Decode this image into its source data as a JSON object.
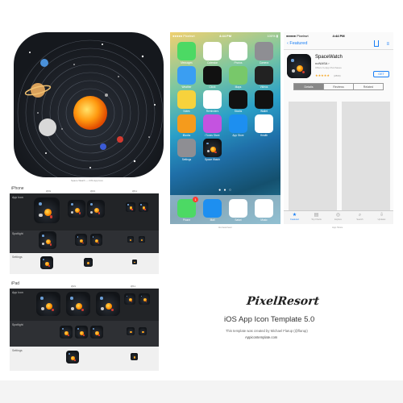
{
  "big_icon": {
    "caption": "Space Watch — iOS App Icon"
  },
  "iphone": {
    "label": "iPhone",
    "columns": [
      "@3x",
      "@2x",
      "@1x"
    ],
    "rows": [
      "App Icon",
      "Spotlight",
      "Settings"
    ]
  },
  "ipad": {
    "label": "iPad",
    "columns": [
      "@2x",
      "@1x"
    ],
    "rows": [
      "App Icon",
      "Spotlight",
      "Settings"
    ]
  },
  "home": {
    "carrier": "●●●●● Pixelrsrt",
    "time": "4:44 PM",
    "battery": "100% ▮",
    "apps": [
      {
        "label": "Messages",
        "color": "#4cd964"
      },
      {
        "label": "Calendar",
        "color": "#ffffff"
      },
      {
        "label": "Photos",
        "color": "#ffffff"
      },
      {
        "label": "Camera",
        "color": "#8e8e93"
      },
      {
        "label": "Weather",
        "color": "#3a9ef2"
      },
      {
        "label": "Clock",
        "color": "#111111"
      },
      {
        "label": "Maps",
        "color": "#78c86a"
      },
      {
        "label": "Videos",
        "color": "#222222"
      },
      {
        "label": "Notes",
        "color": "#f7d23c"
      },
      {
        "label": "Reminders",
        "color": "#ffffff"
      },
      {
        "label": "Stocks",
        "color": "#111111"
      },
      {
        "label": "Wallet",
        "color": "#111111"
      },
      {
        "label": "iBooks",
        "color": "#f59b1c"
      },
      {
        "label": "iTunes Store",
        "color": "#c453e0"
      },
      {
        "label": "App Store",
        "color": "#1d8ff0"
      },
      {
        "label": "Health",
        "color": "#ffffff"
      },
      {
        "label": "Settings",
        "color": "#8e8e93"
      },
      {
        "label": "Space Watch",
        "color": "#15181d"
      }
    ],
    "dock": [
      {
        "label": "Phone",
        "color": "#4cd964",
        "badge": "1"
      },
      {
        "label": "Mail",
        "color": "#1d8ff0"
      },
      {
        "label": "Safari",
        "color": "#ffffff"
      },
      {
        "label": "Music",
        "color": "#ffffff"
      }
    ],
    "page_dots": "● ● ○",
    "caption": "Homescreen"
  },
  "store": {
    "carrier": "●●●●● Pixelrsrt",
    "time": "4:44 PM",
    "back": "‹ Featured",
    "app_name": "SpaceWatch",
    "developer": "noNASA ›",
    "iap": "Offers In-App Purchases",
    "stars": "★★★★★",
    "rating_count": "(2869)",
    "get": "GET",
    "segments": [
      "Details",
      "Reviews",
      "Related"
    ],
    "tabs": [
      {
        "icon": "★",
        "label": "Featured"
      },
      {
        "icon": "▤",
        "label": "Top Charts"
      },
      {
        "icon": "◎",
        "label": "Explore"
      },
      {
        "icon": "⌕",
        "label": "Search"
      },
      {
        "icon": "⇩",
        "label": "Updates"
      }
    ],
    "caption": "App Store"
  },
  "brand": {
    "logo": "PixelResort",
    "title": "iOS App Icon Template 5.0",
    "credit": "This template was created by Michael Flarup (@flarup)",
    "url": "Appicontemplate.com"
  }
}
